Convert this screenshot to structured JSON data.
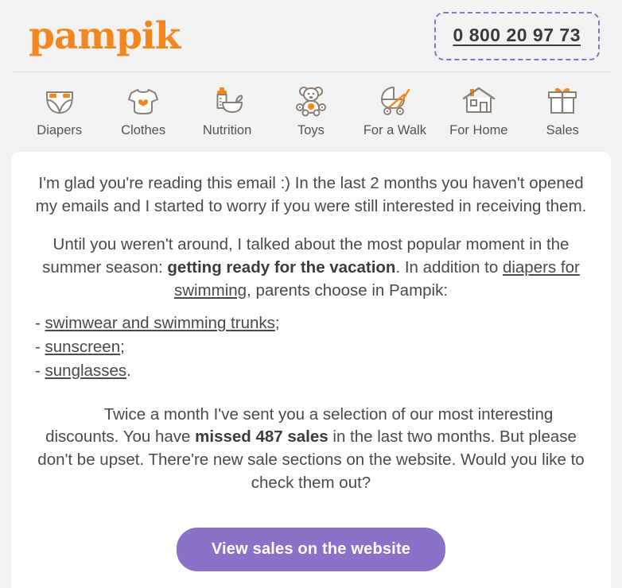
{
  "header": {
    "logo_text": "pampik",
    "logo_color": "#f2871f",
    "phone_number": "0 800 20 97 73",
    "phone_border_color": "#8a72c8"
  },
  "nav": {
    "items": [
      {
        "label": "Diapers",
        "icon": "diaper-icon"
      },
      {
        "label": "Clothes",
        "icon": "onesie-icon"
      },
      {
        "label": "Nutrition",
        "icon": "bottle-bowl-icon"
      },
      {
        "label": "Toys",
        "icon": "teddy-bear-icon"
      },
      {
        "label": "For a Walk",
        "icon": "stroller-icon"
      },
      {
        "label": "For Home",
        "icon": "house-icon"
      },
      {
        "label": "Sales",
        "icon": "gift-icon"
      }
    ]
  },
  "body": {
    "paragraph1": "I'm glad you're reading this email :) In the last 2 months you haven't opened my emails and I started to worry if you were still interested in receiving them.",
    "paragraph2": {
      "part1": "Until you weren't around, I talked about the most popular moment in the summer season: ",
      "bold1": "getting ready for the vacation",
      "part2": ". In addition to ",
      "link1": "diapers for swimming",
      "part3": ", parents choose in Pampik:"
    },
    "list": [
      {
        "dash": "- ",
        "link": "swimwear and swimming trunks",
        "tail": ";"
      },
      {
        "dash": "- ",
        "link": "sunscreen",
        "tail": ";"
      },
      {
        "dash": "- ",
        "link": "sunglasses",
        "tail": "."
      }
    ],
    "paragraph3": {
      "part1": "Twice a month I've sent you a selection of our most interesting discounts. You have ",
      "bold1": "missed 487 sales",
      "part2": " in the last two months. But please don't be upset. There're new sale sections on the website. Would you like to check them out?"
    }
  },
  "cta": {
    "label": "View sales on the website",
    "color": "#8a72c8"
  }
}
